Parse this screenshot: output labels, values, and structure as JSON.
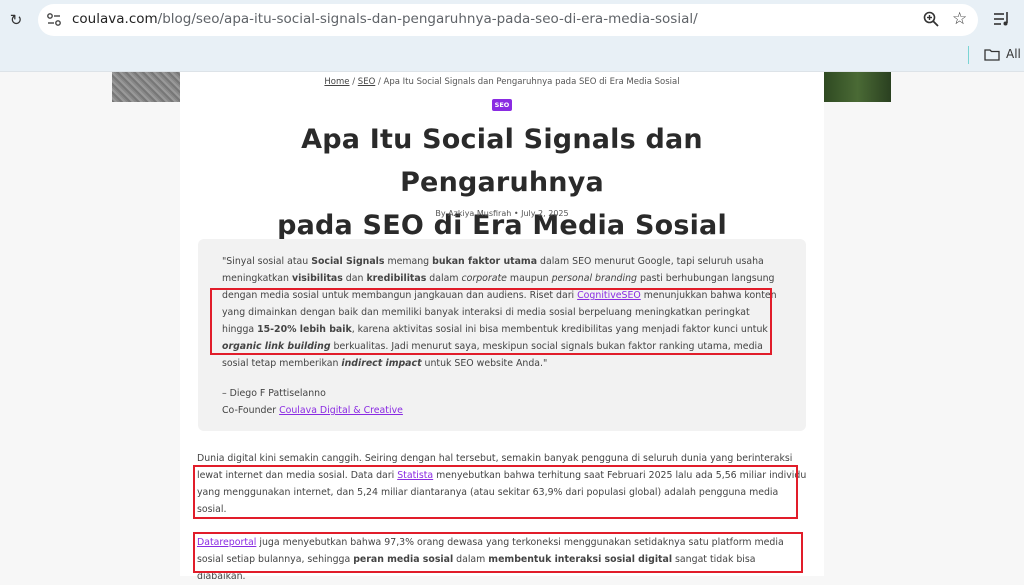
{
  "browser": {
    "url_domain": "coulava.com",
    "url_path": "/blog/seo/apa-itu-social-signals-dan-pengaruhnya-pada-seo-di-era-media-sosial/",
    "bookmarks_label": "All B"
  },
  "article": {
    "breadcrumb": {
      "home": "Home",
      "sep1": " / ",
      "seo": "SEO",
      "sep2": " / ",
      "current": "Apa Itu Social Signals dan Pengaruhnya pada SEO di Era Media Sosial"
    },
    "badge": "SEO",
    "title_line1": "Apa Itu Social Signals dan Pengaruhnya",
    "title_line2": "pada SEO di Era Media Sosial",
    "byline": "By Azkiya Musfirah • July 2, 2025",
    "quote": {
      "t1": "\"Sinyal sosial atau ",
      "b1": "Social Signals",
      "t2": " memang ",
      "b2": "bukan faktor utama",
      "t3": " dalam SEO menurut Google, tapi seluruh usaha meningkatkan ",
      "b3": "visibilitas",
      "t4": " dan ",
      "b4": "kredibilitas",
      "t5": " dalam ",
      "i1": "corporate",
      "t6": " maupun ",
      "i2": "personal branding",
      "t7": " pasti berhubungan langsung dengan media sosial untuk membangun jangkauan dan audiens. Riset dari ",
      "link": "CognitiveSEO",
      "t8": " menunjukkan bahwa konten yang dimainkan dengan baik dan memiliki banyak interaksi di media sosial berpeluang meningkatkan peringkat hingga ",
      "b5": "15-20% lebih baik",
      "t9": ", karena aktivitas sosial ini bisa membentuk kredibilitas yang menjadi faktor kunci untuk ",
      "bi1": "organic link building",
      "t10": " berkualitas. Jadi menurut saya, meskipun social signals bukan faktor ranking utama, media sosial tetap memberikan ",
      "bi2": "indirect impact",
      "t11": " untuk SEO website Anda.\"",
      "author": "– Diego F Pattiselanno",
      "role_prefix": "Co-Founder ",
      "role_link": "Coulava Digital & Creative"
    },
    "p1": {
      "t1": "Dunia digital kini semakin canggih. Seiring dengan hal tersebut, semakin banyak pengguna di seluruh dunia yang berinteraksi lewat internet dan media sosial. Data dari ",
      "link": "Statista",
      "t2": " menyebutkan bahwa terhitung saat Februari 2025 lalu ada 5,56 miliar individu yang menggunakan internet, dan 5,24 miliar diantaranya (atau sekitar 63,9% dari populasi global) adalah pengguna media sosial."
    },
    "p2": {
      "link": "Datareportal",
      "t1": " juga menyebutkan bahwa 97,3% orang dewasa yang terkoneksi menggunakan setidaknya satu platform media sosial setiap bulannya, sehingga ",
      "b1": "peran media sosial",
      "t2": " dalam ",
      "b2": "membentuk interaksi sosial digital",
      "t3": " sangat tidak bisa diabaikan."
    }
  },
  "colors": {
    "accent": "#8a2be2",
    "highlight_box": "#e11d2a",
    "browser_bar": "#e8f0f6"
  }
}
